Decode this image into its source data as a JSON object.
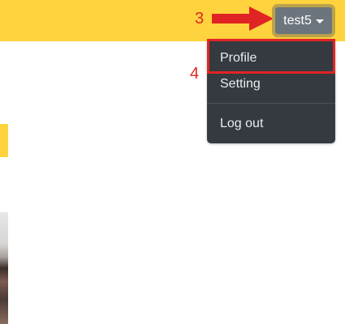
{
  "navbar": {
    "user_menu_label": "test5",
    "accent_color": "#ffd33d"
  },
  "annotations": {
    "step_3": "3",
    "step_4": "4",
    "marker_color": "#e02424"
  },
  "dropdown": {
    "items": [
      {
        "label": "Profile"
      },
      {
        "label": "Setting"
      },
      {
        "label": "Log out"
      }
    ]
  },
  "icons": {
    "user_menu_caret": "chevron-down-icon",
    "pointer_arrow": "arrow-right-icon"
  }
}
